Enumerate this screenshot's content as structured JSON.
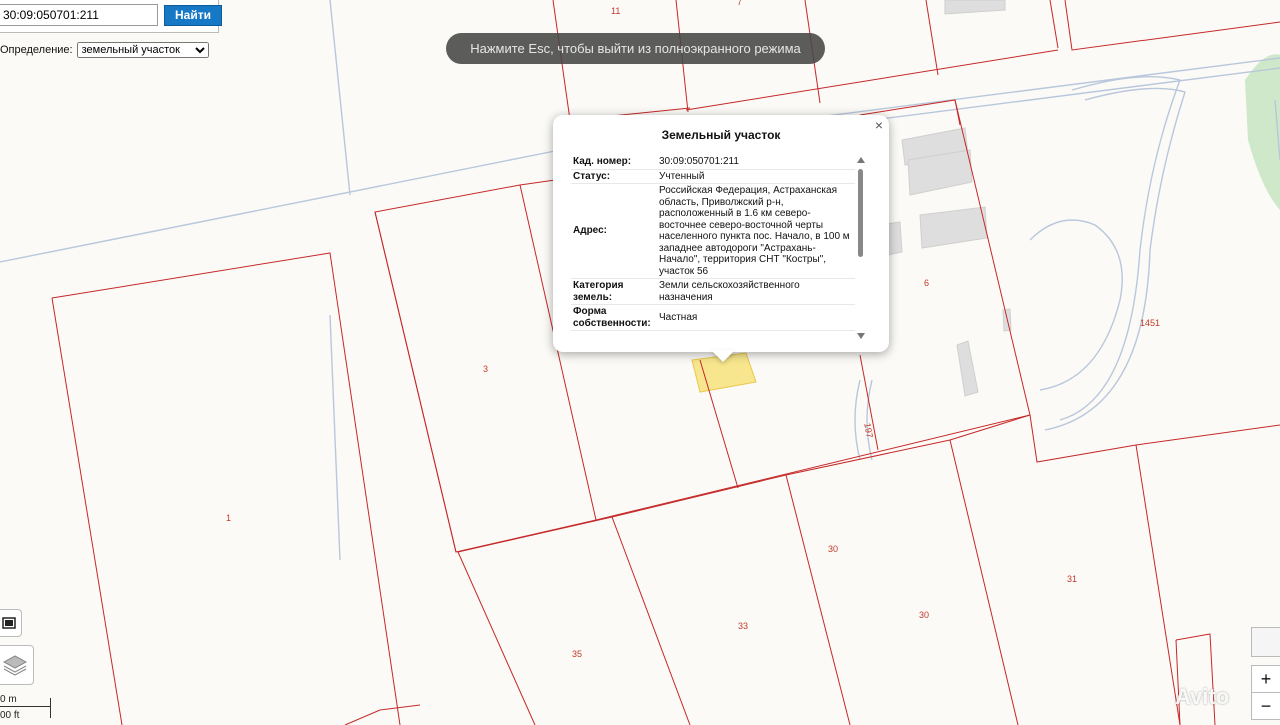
{
  "search": {
    "value": "30:09:050701:211",
    "button_label": "Найти"
  },
  "definition": {
    "label": "Определение:",
    "selected": "земельный участок"
  },
  "fullscreen_notice": "Нажмите Esc, чтобы выйти из полноэкранного режима",
  "popup": {
    "title": "Земельный участок",
    "close_label": "×",
    "rows": [
      {
        "key": "Кад. номер",
        "value": "30:09:050701:211"
      },
      {
        "key": "Статус",
        "value": "Учтенный"
      },
      {
        "key": "Адрес",
        "value": "Российская Федерация, Астраханская область, Приволжский р-н, расположенный в 1.6 км северо-восточнее северо-восточной черты населенного пункта пос. Начало, в 100 м западнее автодороги \"Астрахань-Начало\", территория СНТ \"Костры\", участок 56"
      },
      {
        "key": "Категория земель",
        "value": "Земли сельскохозяйственного назначения"
      },
      {
        "key": "Форма собственности",
        "value": "Частная"
      }
    ]
  },
  "map": {
    "plot_numbers": [
      "11",
      "7",
      "3",
      "1",
      "6",
      "1451",
      "197",
      "30",
      "31",
      "30",
      "33",
      "35"
    ],
    "colors": {
      "boundary": "#c62828",
      "selected_fill": "#f6e27a",
      "road": "#b9c7dc",
      "greenery": "#cfe8c9",
      "building": "#dcdcdc"
    }
  },
  "scale": {
    "metric": "0 m",
    "imperial": "00 ft"
  },
  "zoom": {
    "in": "+",
    "out": "−"
  },
  "watermark": "Avito",
  "icons": {
    "fullscreen": "fullscreen-icon",
    "layers": "layers-icon"
  }
}
